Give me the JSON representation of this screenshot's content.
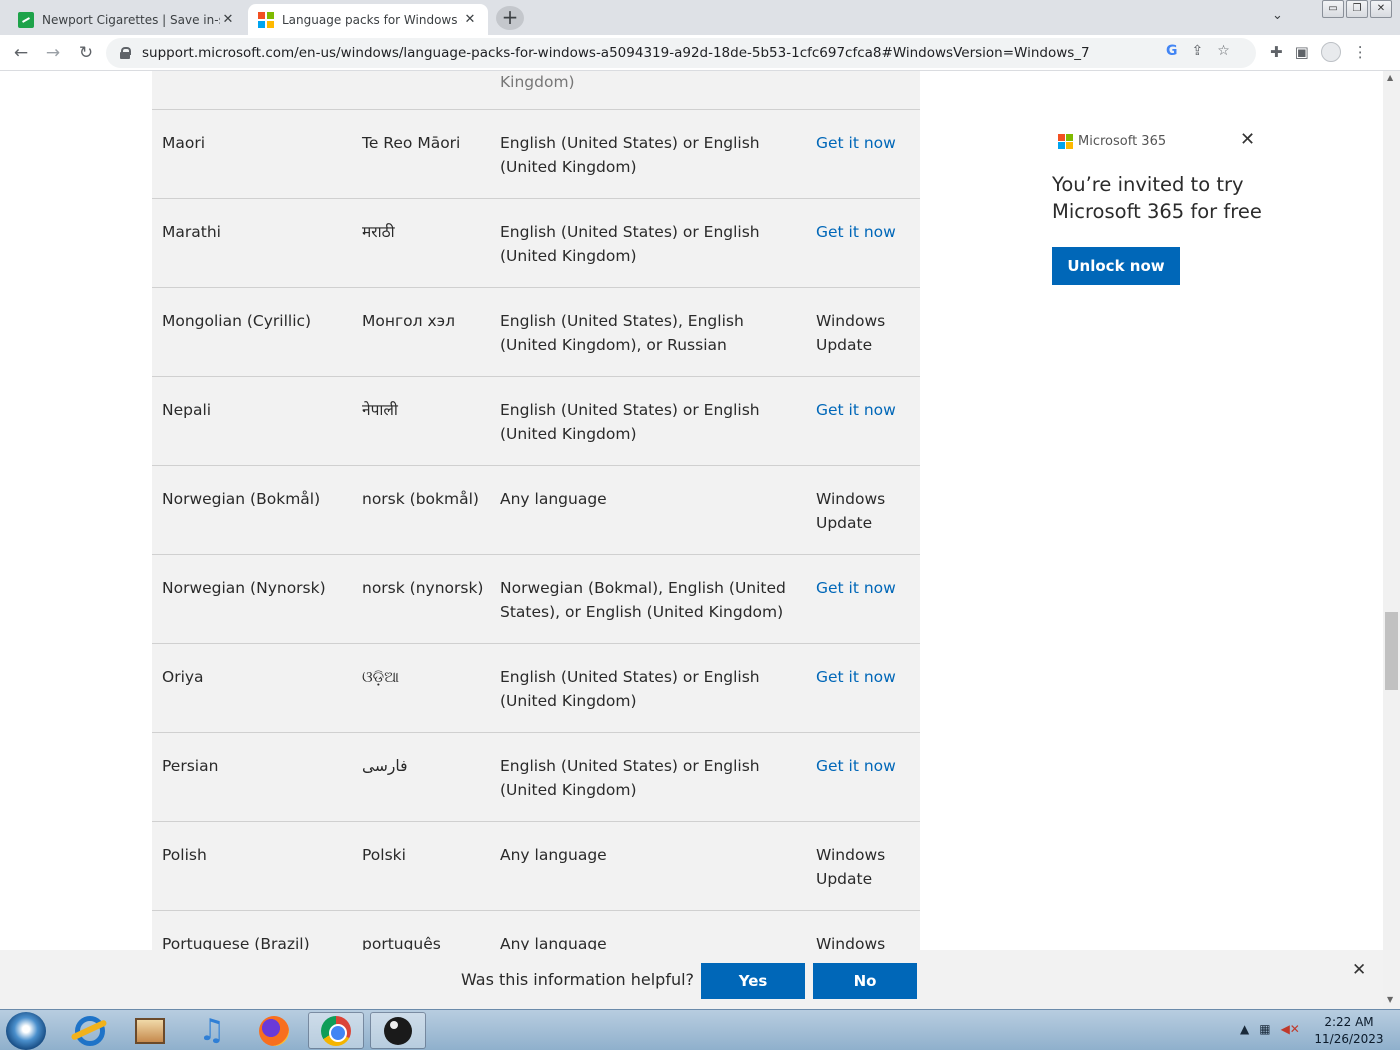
{
  "browser": {
    "tabs": [
      {
        "title": "Newport Cigarettes | Save in-sto",
        "favicon": "newport-favicon",
        "active": false
      },
      {
        "title": "Language packs for Windows - M",
        "favicon": "microsoft-favicon",
        "active": true
      }
    ],
    "new_tab_label": "+",
    "tab_close_glyph": "✕",
    "url": "support.microsoft.com/en-us/windows/language-packs-for-windows-a5094319-a92d-18de-5b53-1cfc697cfca8#WindowsVersion=Windows_7",
    "back_glyph": "←",
    "forward_glyph": "→",
    "reload_glyph": "↻",
    "window_buttons": {
      "minimize": "▭",
      "restore": "❐",
      "close": "✕"
    }
  },
  "table": {
    "rows": [
      {
        "language": "",
        "native": "",
        "base": "Kingdom)",
        "availability": "",
        "link": false
      },
      {
        "language": "Maori",
        "native": "Te Reo Māori",
        "base": "English (United States) or English (United Kingdom)",
        "availability": "Get it now",
        "link": true
      },
      {
        "language": "Marathi",
        "native": "मराठी",
        "base": "English (United States) or English (United Kingdom)",
        "availability": "Get it now",
        "link": true
      },
      {
        "language": "Mongolian (Cyrillic)",
        "native": "Монгол хэл",
        "base": "English (United States), English (United Kingdom), or Russian",
        "availability": "Windows Update",
        "link": false
      },
      {
        "language": "Nepali",
        "native": "नेपाली",
        "base": "English (United States) or English (United Kingdom)",
        "availability": "Get it now",
        "link": true
      },
      {
        "language": "Norwegian (Bokmål)",
        "native": "norsk (bokmål)",
        "base": "Any language",
        "availability": "Windows Update",
        "link": false
      },
      {
        "language": "Norwegian (Nynorsk)",
        "native": "norsk (nynorsk)",
        "base": "Norwegian (Bokmal), English (United States), or English (United Kingdom)",
        "availability": "Get it now",
        "link": true
      },
      {
        "language": "Oriya",
        "native": "ଓଡ଼ିଆ",
        "base": "English (United States) or English (United Kingdom)",
        "availability": "Get it now",
        "link": true
      },
      {
        "language": "Persian",
        "native": "فارسی",
        "base": "English (United States) or English (United Kingdom)",
        "availability": "Get it now",
        "link": true
      },
      {
        "language": "Polish",
        "native": "Polski",
        "base": "Any language",
        "availability": "Windows Update",
        "link": false
      },
      {
        "language": "Portuguese (Brazil)",
        "native": "português",
        "base": "Any language",
        "availability": "Windows Update",
        "link": false
      }
    ]
  },
  "ad": {
    "brand": "Microsoft 365",
    "text": "You’re invited to try Microsoft 365 for free",
    "button": "Unlock now",
    "close_glyph": "✕"
  },
  "feedback": {
    "question": "Was this information helpful?",
    "yes": "Yes",
    "no": "No",
    "close_glyph": "✕"
  },
  "taskbar": {
    "time": "2:22 AM",
    "date": "11/26/2023"
  },
  "colors": {
    "accent": "#0067b8",
    "ms_red": "#f25022",
    "ms_green": "#7fba00",
    "ms_blue": "#00a4ef",
    "ms_yellow": "#ffb900"
  }
}
